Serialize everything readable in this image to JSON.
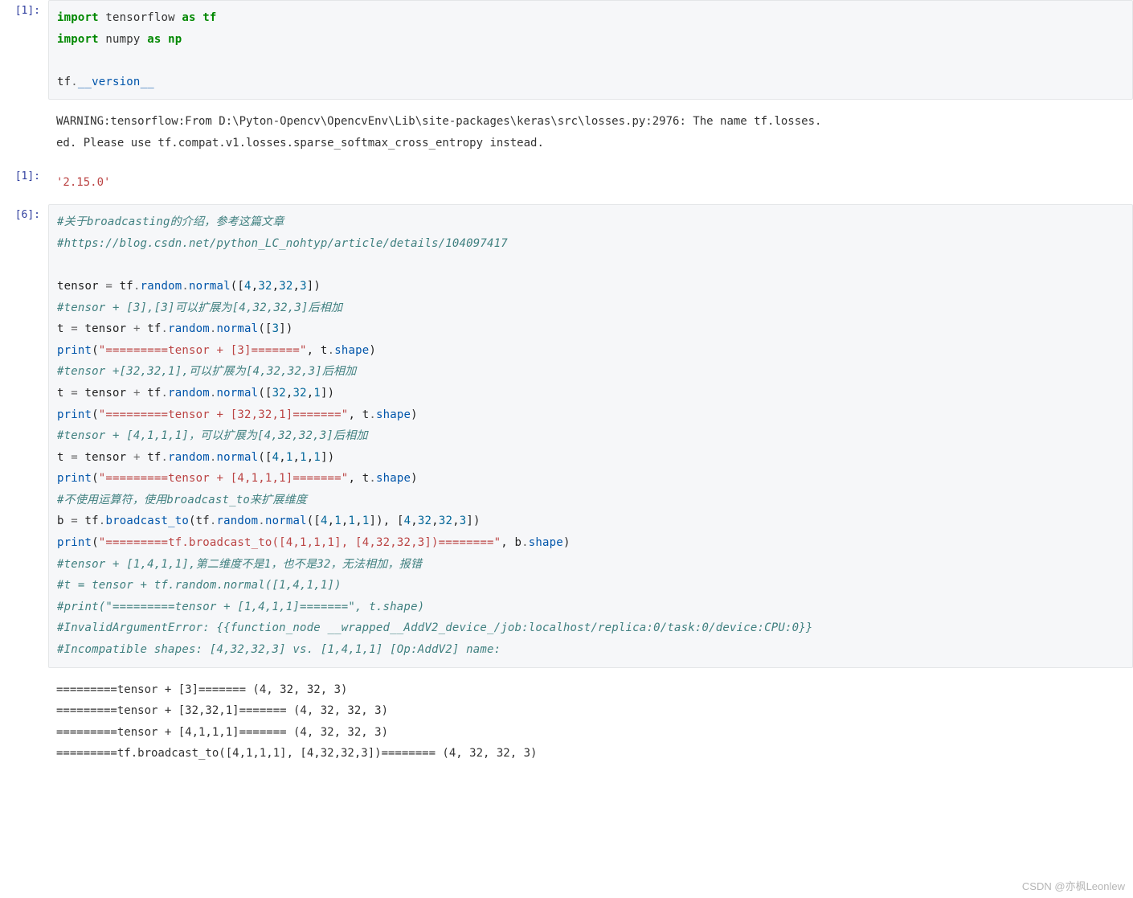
{
  "cells": {
    "c1": {
      "prompt": "[1]:",
      "code": {
        "import1_kw": "import",
        "import1_mod": "tensorflow",
        "import1_as": "as",
        "import1_alias": "tf",
        "import2_kw": "import",
        "import2_mod": "numpy",
        "import2_as": "as",
        "import2_alias": "np",
        "blank": "",
        "l3_pre": "tf",
        "l3_dot": ".",
        "l3_attr": "__version__"
      }
    },
    "c1_warn": {
      "text": "WARNING:tensorflow:From D:\\Pyton-Opencv\\OpencvEnv\\Lib\\site-packages\\keras\\src\\losses.py:2976: The name tf.losses.\ned. Please use tf.compat.v1.losses.sparse_softmax_cross_entropy instead."
    },
    "c1_out": {
      "prompt": "[1]:",
      "value": "'2.15.0'"
    },
    "c6": {
      "prompt": "[6]:",
      "lines": {
        "cmt1": "#关于broadcasting的介绍，参考这篇文章",
        "cmt2": "#https://blog.csdn.net/python_LC_nohtyp/article/details/104097417",
        "blank1": "",
        "l1_a": "tensor ",
        "l1_op": "=",
        "l1_b": " tf",
        "l1_c": ".",
        "l1_d": "random",
        "l1_e": ".",
        "l1_f": "normal",
        "l1_g": "([",
        "l1_n1": "4",
        "l1_s1": ",",
        "l1_n2": "32",
        "l1_s2": ",",
        "l1_n3": "32",
        "l1_s3": ",",
        "l1_n4": "3",
        "l1_h": "])",
        "cmt3": "#tensor + [3],[3]可以扩展为[4,32,32,3]后相加",
        "l2_a": "t ",
        "l2_op": "=",
        "l2_b": " tensor ",
        "l2_op2": "+",
        "l2_c": " tf",
        "l2_d": ".",
        "l2_e": "random",
        "l2_f": ".",
        "l2_g": "normal",
        "l2_h": "([",
        "l2_n1": "3",
        "l2_i": "])",
        "l3_a": "print",
        "l3_b": "(",
        "l3_str": "\"=========tensor + [3]=======\"",
        "l3_c": ", t",
        "l3_d": ".",
        "l3_e": "shape",
        "l3_f": ")",
        "cmt4": "#tensor +[32,32,1],可以扩展为[4,32,32,3]后相加",
        "l4_a": "t ",
        "l4_op": "=",
        "l4_b": " tensor ",
        "l4_op2": "+",
        "l4_c": " tf",
        "l4_d": ".",
        "l4_e": "random",
        "l4_f": ".",
        "l4_g": "normal",
        "l4_h": "([",
        "l4_n1": "32",
        "l4_s1": ",",
        "l4_n2": "32",
        "l4_s2": ",",
        "l4_n3": "1",
        "l4_i": "])",
        "l5_a": "print",
        "l5_b": "(",
        "l5_str": "\"=========tensor + [32,32,1]=======\"",
        "l5_c": ", t",
        "l5_d": ".",
        "l5_e": "shape",
        "l5_f": ")",
        "cmt5": "#tensor + [4,1,1,1]，可以扩展为[4,32,32,3]后相加",
        "l6_a": "t ",
        "l6_op": "=",
        "l6_b": " tensor ",
        "l6_op2": "+",
        "l6_c": " tf",
        "l6_d": ".",
        "l6_e": "random",
        "l6_f": ".",
        "l6_g": "normal",
        "l6_h": "([",
        "l6_n1": "4",
        "l6_s1": ",",
        "l6_n2": "1",
        "l6_s2": ",",
        "l6_n3": "1",
        "l6_s3": ",",
        "l6_n4": "1",
        "l6_i": "])",
        "l7_a": "print",
        "l7_b": "(",
        "l7_str": "\"=========tensor + [4,1,1,1]=======\"",
        "l7_c": ", t",
        "l7_d": ".",
        "l7_e": "shape",
        "l7_f": ")",
        "cmt6": "#不使用运算符，使用broadcast_to来扩展维度",
        "l8_a": "b ",
        "l8_op": "=",
        "l8_b": " tf",
        "l8_c": ".",
        "l8_d": "broadcast_to",
        "l8_e": "(tf",
        "l8_f": ".",
        "l8_g": "random",
        "l8_h": ".",
        "l8_i": "normal",
        "l8_j": "([",
        "l8_n1": "4",
        "l8_s1": ",",
        "l8_n2": "1",
        "l8_s2": ",",
        "l8_n3": "1",
        "l8_s3": ",",
        "l8_n4": "1",
        "l8_k": "]), [",
        "l8_n5": "4",
        "l8_s4": ",",
        "l8_n6": "32",
        "l8_s5": ",",
        "l8_n7": "32",
        "l8_s6": ",",
        "l8_n8": "3",
        "l8_l": "])",
        "l9_a": "print",
        "l9_b": "(",
        "l9_str": "\"=========tf.broadcast_to([4,1,1,1], [4,32,32,3])========\"",
        "l9_c": ", b",
        "l9_d": ".",
        "l9_e": "shape",
        "l9_f": ")",
        "cmt7": "#tensor + [1,4,1,1],第二维度不是1，也不是32，无法相加，报错",
        "cmt8": "#t = tensor + tf.random.normal([1,4,1,1])",
        "cmt9": "#print(\"=========tensor + [1,4,1,1]=======\", t.shape)",
        "cmt10": "#InvalidArgumentError: {{function_node __wrapped__AddV2_device_/job:localhost/replica:0/task:0/device:CPU:0}}",
        "cmt11": "#Incompatible shapes: [4,32,32,3] vs. [1,4,1,1] [Op:AddV2] name:"
      }
    },
    "c6_out": {
      "text": "=========tensor + [3]======= (4, 32, 32, 3)\n=========tensor + [32,32,1]======= (4, 32, 32, 3)\n=========tensor + [4,1,1,1]======= (4, 32, 32, 3)\n=========tf.broadcast_to([4,1,1,1], [4,32,32,3])======== (4, 32, 32, 3)"
    }
  },
  "watermark": "CSDN @亦枫Leonlew"
}
